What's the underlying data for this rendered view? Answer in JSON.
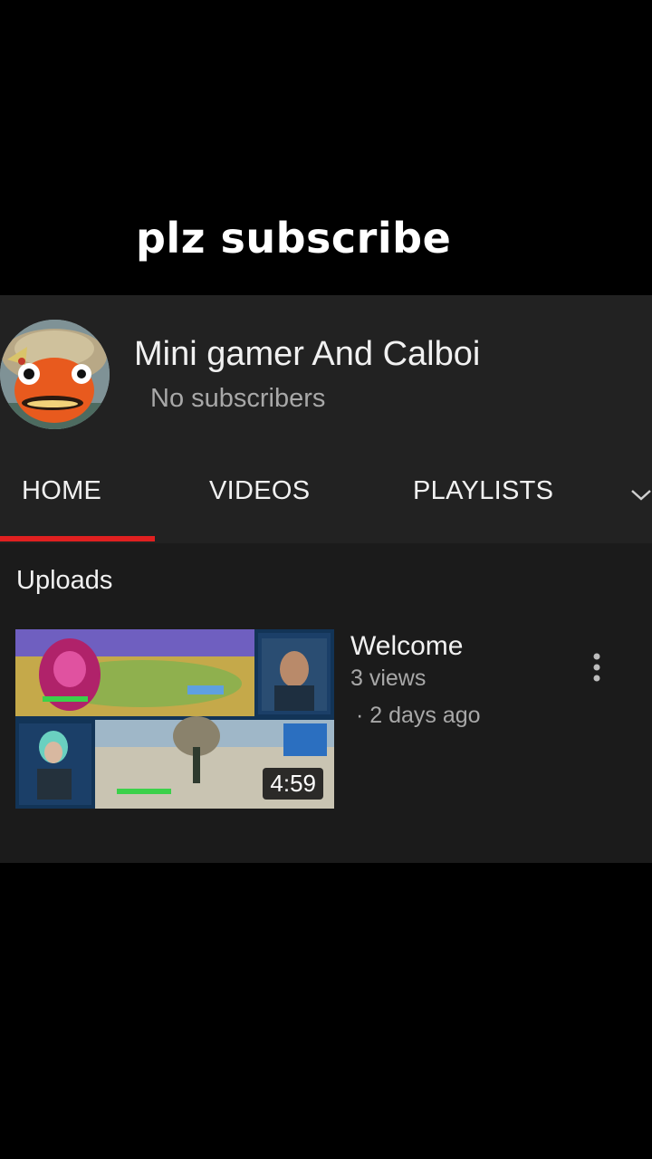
{
  "overlay": {
    "caption": "plz subscribe"
  },
  "channel": {
    "name": "Mini gamer And Calboi",
    "subscribers": "No subscribers",
    "avatar_icon": "fishstick-avatar"
  },
  "tabs": [
    {
      "label": "HOME",
      "active": true
    },
    {
      "label": "VIDEOS",
      "active": false
    },
    {
      "label": "PLAYLISTS",
      "active": false
    }
  ],
  "tabs_more_icon": "chevron-down-icon",
  "sections": {
    "uploads": {
      "title": "Uploads",
      "videos": [
        {
          "title": "Welcome",
          "views": "3 views",
          "age": "· 2 days ago",
          "duration": "4:59",
          "menu_icon": "more-vert-icon"
        }
      ]
    }
  },
  "colors": {
    "background": "#000000",
    "panel": "#1b1b1b",
    "header": "#222222",
    "accent": "#e02020",
    "text_primary": "#f1f1f1",
    "text_secondary": "#a8a8a8"
  }
}
